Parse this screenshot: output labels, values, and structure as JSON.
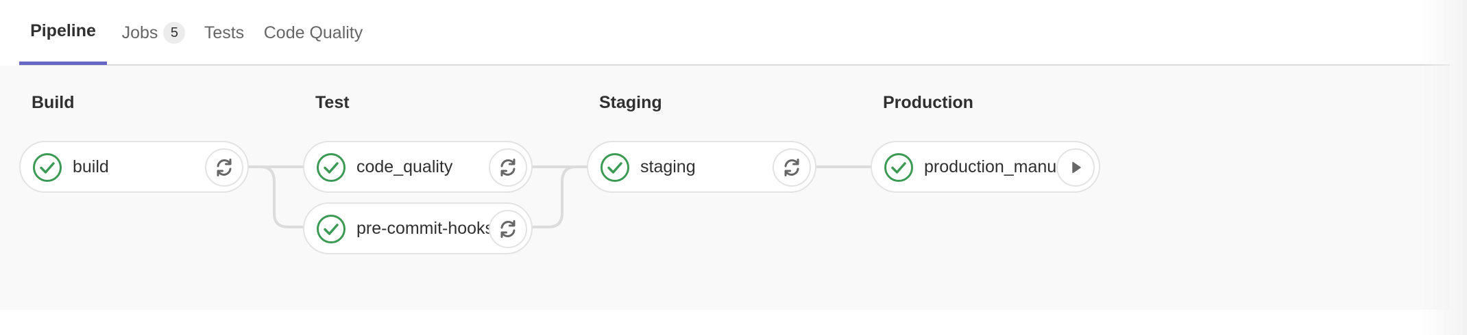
{
  "tabs": [
    {
      "label": "Pipeline",
      "active": true
    },
    {
      "label": "Jobs",
      "count": "5"
    },
    {
      "label": "Tests"
    },
    {
      "label": "Code Quality"
    }
  ],
  "stages": [
    {
      "title": "Build",
      "jobs": [
        {
          "name": "build",
          "status": "success",
          "action": "retry-icon"
        }
      ]
    },
    {
      "title": "Test",
      "jobs": [
        {
          "name": "code_quality",
          "status": "success",
          "action": "retry-icon"
        },
        {
          "name": "pre-commit-hooks",
          "status": "success",
          "action": "retry-icon"
        }
      ]
    },
    {
      "title": "Staging",
      "jobs": [
        {
          "name": "staging",
          "status": "success",
          "action": "retry-icon"
        }
      ]
    },
    {
      "title": "Production",
      "jobs": [
        {
          "name": "production_manual",
          "status": "success",
          "action": "play-icon"
        }
      ]
    }
  ],
  "colors": {
    "success": "#3c9a54",
    "accent": "#6666c4"
  }
}
